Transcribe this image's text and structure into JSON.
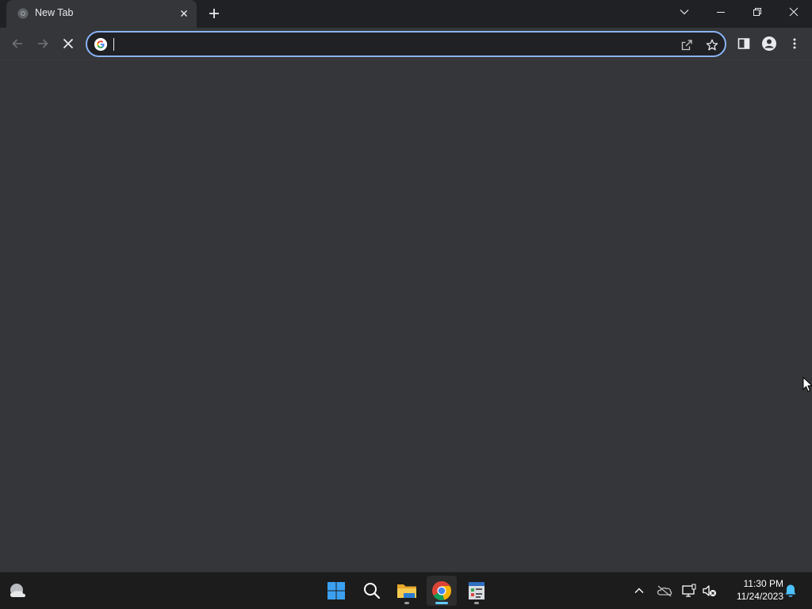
{
  "browser": {
    "tab": {
      "title": "New Tab"
    },
    "omnibox": {
      "value": "",
      "placeholder": ""
    }
  },
  "taskbar": {
    "clock": {
      "time": "11:30 PM",
      "date": "11/24/2023"
    }
  },
  "colors": {
    "accent": "#8ab4f8",
    "frame": "#202124",
    "toolbar": "#35363a",
    "taskbar": "#1c1c1c",
    "indicator_active": "#60cdff"
  }
}
